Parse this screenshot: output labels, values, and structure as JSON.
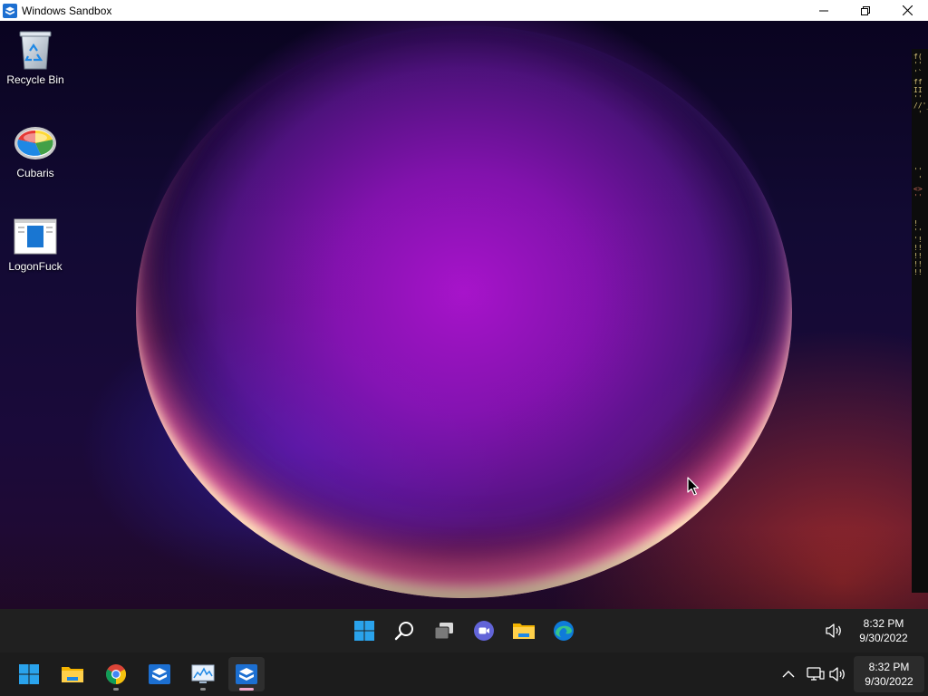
{
  "window": {
    "title": "Windows Sandbox",
    "controls": [
      "minimize-icon",
      "restore-icon",
      "close-icon"
    ]
  },
  "desktop": {
    "icons": [
      {
        "label": "Recycle Bin",
        "icon": "recycle-bin-icon"
      },
      {
        "label": "Cubaris",
        "icon": "cubaris-icon"
      },
      {
        "label": "LogonFuck",
        "icon": "document-icon"
      }
    ]
  },
  "sandbox_taskbar": {
    "apps": [
      "start-icon",
      "search-icon",
      "task-view-icon",
      "chat-icon",
      "file-explorer-icon",
      "edge-icon"
    ],
    "tray_icons": [
      "volume-icon"
    ],
    "clock": {
      "time": "8:32 PM",
      "date": "9/30/2022"
    }
  },
  "host_taskbar": {
    "apps": [
      "start-icon",
      "file-explorer-icon",
      "chrome-icon",
      "sandbox-icon",
      "resource-monitor-icon",
      "sandbox-icon"
    ],
    "tray_icons": [
      "chevron-up-icon",
      "network-icon",
      "volume-icon"
    ],
    "clock": {
      "time": "8:32 PM",
      "date": "9/30/2022"
    }
  },
  "colors": {
    "taskbar": "#202020",
    "accent": "#0078d4",
    "active_indicator": "#f0a6c8"
  }
}
